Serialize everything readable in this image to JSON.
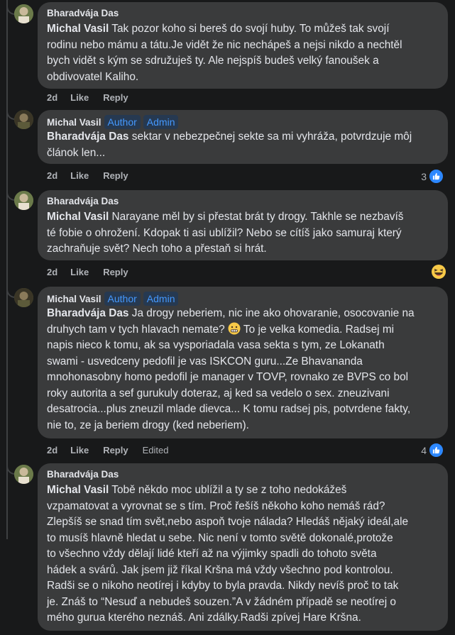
{
  "comments": [
    {
      "author": "Bharadvája Das",
      "mention": "Michal Vasil",
      "lines": [
        " Tak pozor koho si bereš do svojí huby. To můžeš tak svojí",
        "rodinu nebo mámu a tátu.Je vidět že nic nechápeš a nejsi nikdo a nechtěl",
        "bych vidět s kým se sdružuješ ty. Ale nejspíš budeš velký fanoušek a",
        "obdivovatel Kaliho."
      ],
      "age": "2d",
      "like": "Like",
      "reply": "Reply"
    },
    {
      "author": "Michal Vasil",
      "badges": [
        "Author",
        "Admin"
      ],
      "mention": "Bharadvája Das",
      "lines": [
        " sektar v nebezpečnej sekte sa mi vyhráža, potvrdzuje môj",
        "článok len..."
      ],
      "age": "2d",
      "like": "Like",
      "reply": "Reply",
      "reaction_count": "3"
    },
    {
      "author": "Bharadvája Das",
      "mention": "Michal Vasil",
      "lines": [
        " Narayane měl by si přestat brát ty drogy. Takhle se nezbavíš",
        "té fobie o ohrožení. Kdopak ti asi ublížil? Nebo se cítíš jako samuraj který",
        "zachraňuje svět? Nech toho a přestaň si hrát."
      ],
      "age": "2d",
      "like": "Like",
      "reply": "Reply",
      "reaction": "laughing-emoji"
    },
    {
      "author": "Michal Vasil",
      "badges": [
        "Author",
        "Admin"
      ],
      "mention": "Bharadvája Das",
      "lines": [
        " Ja drogy neberiem, nic ine ako ohovaranie, osocovanie na",
        "druhych tam v tych hlavach nemate? ",
        " To je velka komedia. Radsej mi",
        "napis nieco k tomu, ak sa vysporiadala vasa sekta s tym, ze Lokanath",
        "swami - usvedceny pedofil je vas ISKCON guru...Ze Bhavananda",
        "mnohonasobny homo pedofil je manager v TOVP, rovnako ze BVPS co bol",
        "roky autorita a sef gurukuly doteraz, aj ked sa vedelo o sex. zneuzivani",
        "desatrocia...plus zneuzil mlade dievca... K tomu radsej pis, potvrdene fakty,",
        "nie to, ze ja beriem drogy (ked neberiem)."
      ],
      "age": "2d",
      "like": "Like",
      "reply": "Reply",
      "edited": "Edited",
      "reaction_count": "4"
    },
    {
      "author": "Bharadvája Das",
      "mention": "Michal Vasil",
      "lines": [
        " Tobě někdo moc ublížil a ty se z toho nedokážeš",
        "vzpamatovat a vyrovnat se s tím. Proč řešíš někoho koho nemáš rád?",
        "Zlepšíš se snad tím svět,nebo aspoň tvoje nálada? Hledáš nějaký ideál,ale",
        "to musíš hlavně hledat u sebe. Nic není v tomto světě dokonalé,protože",
        "to všechno vždy dělají lidé kteří až na výjimky spadli do tohoto světa",
        "hádek a svárů. Jak jsem již říkal Kršna má vždy všechno pod kontrolou.",
        "Radši se o nikoho neotírej i kdyby to byla pravda. Nikdy nevíš proč to tak",
        "je. Znáš to “Nesuď a nebudeš souzen.”A v žádném případě se neotírej o",
        "mého gurua kterého neznáš. Ani zdálky.Radši zpívej Hare Kršna."
      ]
    }
  ],
  "colors": {
    "background": "#18191a",
    "bubble": "#3a3b3c",
    "badge_bg": "#263951",
    "badge_text": "#4599ff",
    "like_blue": "#2d88ff"
  }
}
